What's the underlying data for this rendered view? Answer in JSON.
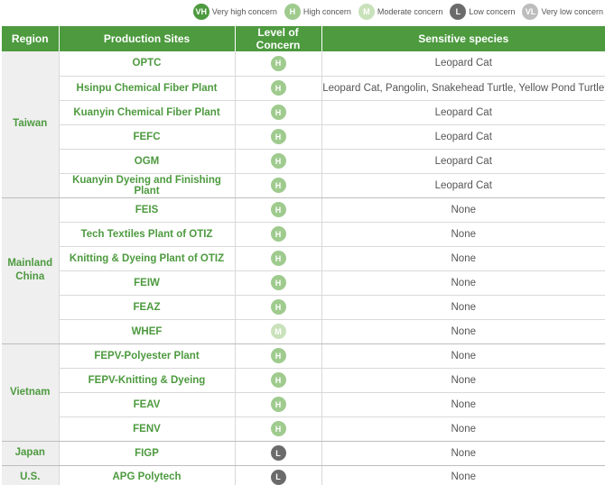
{
  "legend": [
    {
      "code": "VH",
      "label": "Very high concern"
    },
    {
      "code": "H",
      "label": "High concern"
    },
    {
      "code": "M",
      "label": "Moderate concern"
    },
    {
      "code": "L",
      "label": "Low concern"
    },
    {
      "code": "VL",
      "label": "Very low concern"
    }
  ],
  "headers": {
    "region": "Region",
    "site": "Production Sites",
    "concern": "Level of Concern",
    "species": "Sensitive species"
  },
  "groups": [
    {
      "region": "Taiwan",
      "rows": [
        {
          "site": "OPTC",
          "concern": "H",
          "species": "Leopard Cat"
        },
        {
          "site": "Hsinpu Chemical Fiber Plant",
          "concern": "H",
          "species": "Leopard Cat, Pangolin, Snakehead Turtle, Yellow Pond Turtle"
        },
        {
          "site": "Kuanyin Chemical Fiber Plant",
          "concern": "H",
          "species": "Leopard Cat"
        },
        {
          "site": "FEFC",
          "concern": "H",
          "species": "Leopard Cat"
        },
        {
          "site": "OGM",
          "concern": "H",
          "species": "Leopard Cat"
        },
        {
          "site": "Kuanyin Dyeing and Finishing Plant",
          "concern": "H",
          "species": "Leopard Cat"
        }
      ]
    },
    {
      "region": "Mainland China",
      "rows": [
        {
          "site": "FEIS",
          "concern": "H",
          "species": "None"
        },
        {
          "site": "Tech Textiles Plant of OTIZ",
          "concern": "H",
          "species": "None"
        },
        {
          "site": "Knitting & Dyeing Plant of OTIZ",
          "concern": "H",
          "species": "None"
        },
        {
          "site": "FEIW",
          "concern": "H",
          "species": "None"
        },
        {
          "site": "FEAZ",
          "concern": "H",
          "species": "None"
        },
        {
          "site": "WHEF",
          "concern": "M",
          "species": "None"
        }
      ]
    },
    {
      "region": "Vietnam",
      "rows": [
        {
          "site": "FEPV-Polyester Plant",
          "concern": "H",
          "species": "None"
        },
        {
          "site": "FEPV-Knitting & Dyeing",
          "concern": "H",
          "species": "None"
        },
        {
          "site": "FEAV",
          "concern": "H",
          "species": "None"
        },
        {
          "site": "FENV",
          "concern": "H",
          "species": "None"
        }
      ]
    },
    {
      "region": "Japan",
      "rows": [
        {
          "site": "FIGP",
          "concern": "L",
          "species": "None"
        }
      ]
    },
    {
      "region": "U.S.",
      "rows": [
        {
          "site": "APG Polytech",
          "concern": "L",
          "species": "None"
        }
      ]
    }
  ]
}
